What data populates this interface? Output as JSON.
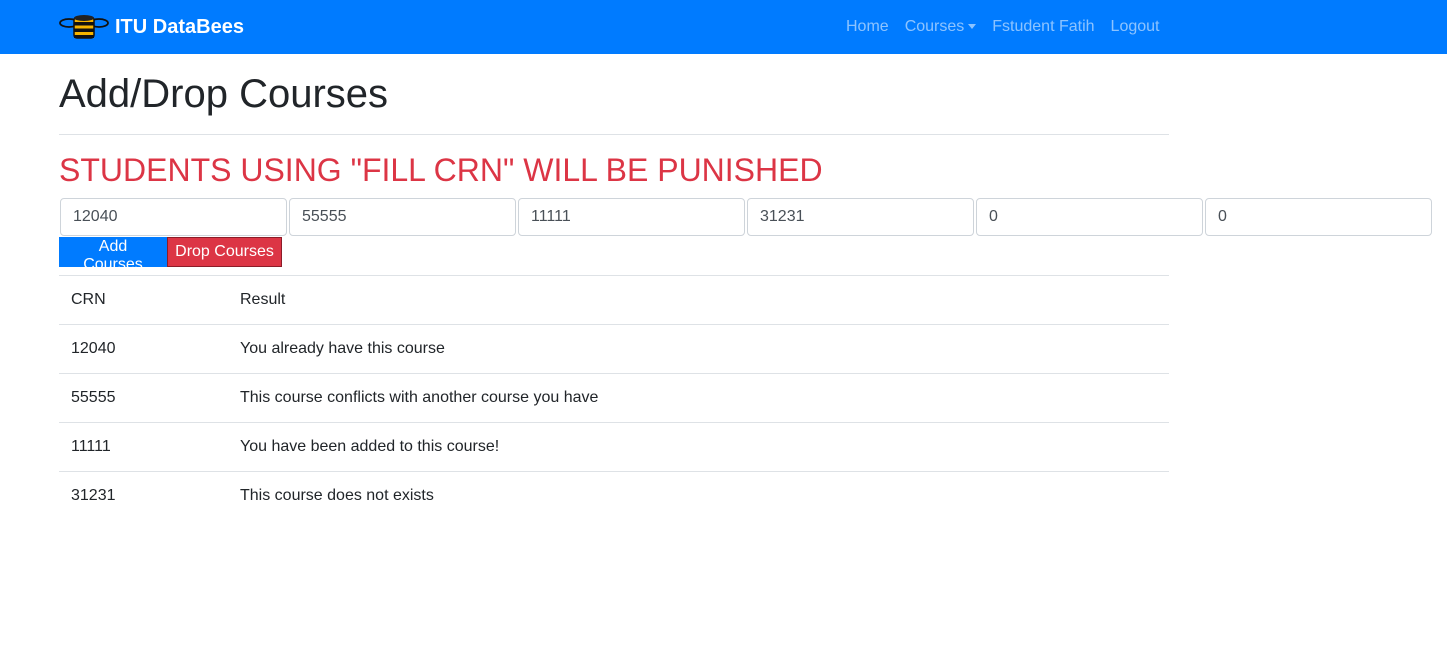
{
  "navbar": {
    "brand": "ITU DataBees",
    "logo_icon": "bee-database-icon",
    "links": [
      {
        "label": "Home"
      },
      {
        "label": "Courses",
        "dropdown": true
      },
      {
        "label": "Fstudent Fatih"
      },
      {
        "label": "Logout"
      }
    ]
  },
  "page": {
    "title": "Add/Drop Courses",
    "warning": "STUDENTS USING \"FILL CRN\" WILL BE PUNISHED"
  },
  "crn_inputs": [
    "12040",
    "55555",
    "11111",
    "31231",
    "0",
    "0"
  ],
  "buttons": {
    "add": "Add Courses",
    "drop": "Drop Courses"
  },
  "results_table": {
    "headers": [
      "CRN",
      "Result"
    ],
    "rows": [
      {
        "crn": "12040",
        "result": "You already have this course"
      },
      {
        "crn": "55555",
        "result": "This course conflicts with another course you have"
      },
      {
        "crn": "11111",
        "result": "You have been added to this course!"
      },
      {
        "crn": "31231",
        "result": "This course does not exists"
      }
    ]
  },
  "colors": {
    "navbar": "#007bff",
    "warning": "#dc3545",
    "add_button": "#007bff",
    "drop_button": "#dc3545"
  }
}
